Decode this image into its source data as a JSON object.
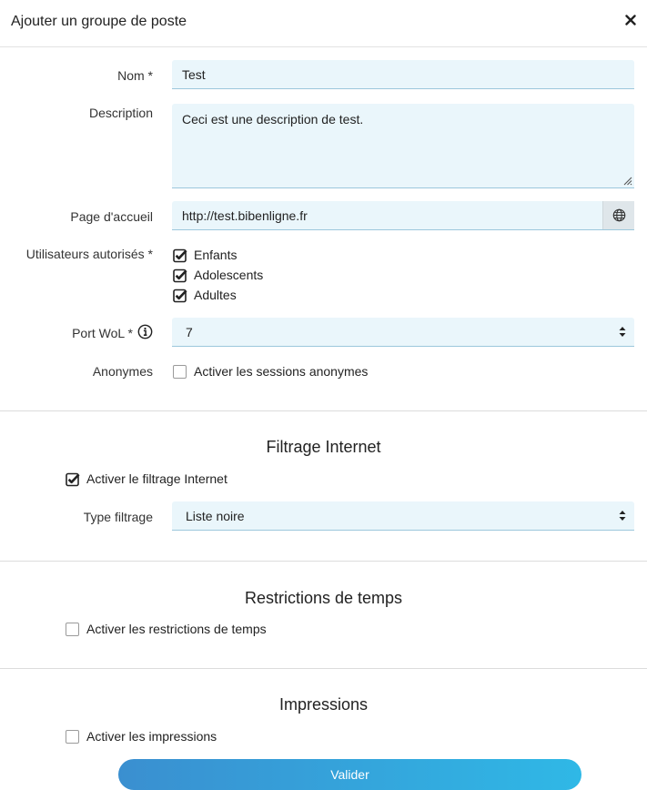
{
  "modal": {
    "title": "Ajouter un groupe de poste",
    "close_symbol": "✕"
  },
  "form": {
    "nom": {
      "label": "Nom *",
      "value": "Test"
    },
    "description": {
      "label": "Description",
      "value": "Ceci est une description de test."
    },
    "homepage": {
      "label": "Page d'accueil",
      "value": "http://test.bibenligne.fr"
    },
    "users": {
      "label": "Utilisateurs autorisés *",
      "options": [
        {
          "label": "Enfants",
          "checked": true
        },
        {
          "label": "Adolescents",
          "checked": true
        },
        {
          "label": "Adultes",
          "checked": true
        }
      ]
    },
    "wol": {
      "label": "Port WoL *",
      "value": "7"
    },
    "anonymous": {
      "label": "Anonymes",
      "option_label": "Activer les sessions anonymes",
      "checked": false
    }
  },
  "filtering": {
    "title": "Filtrage Internet",
    "enable_label": "Activer le filtrage Internet",
    "enabled": true,
    "type_label": "Type filtrage",
    "type_value": "Liste noire"
  },
  "time": {
    "title": "Restrictions de temps",
    "enable_label": "Activer les restrictions de temps",
    "enabled": false
  },
  "printing": {
    "title": "Impressions",
    "enable_label": "Activer les impressions",
    "enabled": false
  },
  "submit_label": "Valider",
  "colors": {
    "field_bg": "#eaf6fb",
    "field_border": "#9cc7dc",
    "button_start": "#3a8fd0",
    "button_end": "#2fb8e6"
  }
}
